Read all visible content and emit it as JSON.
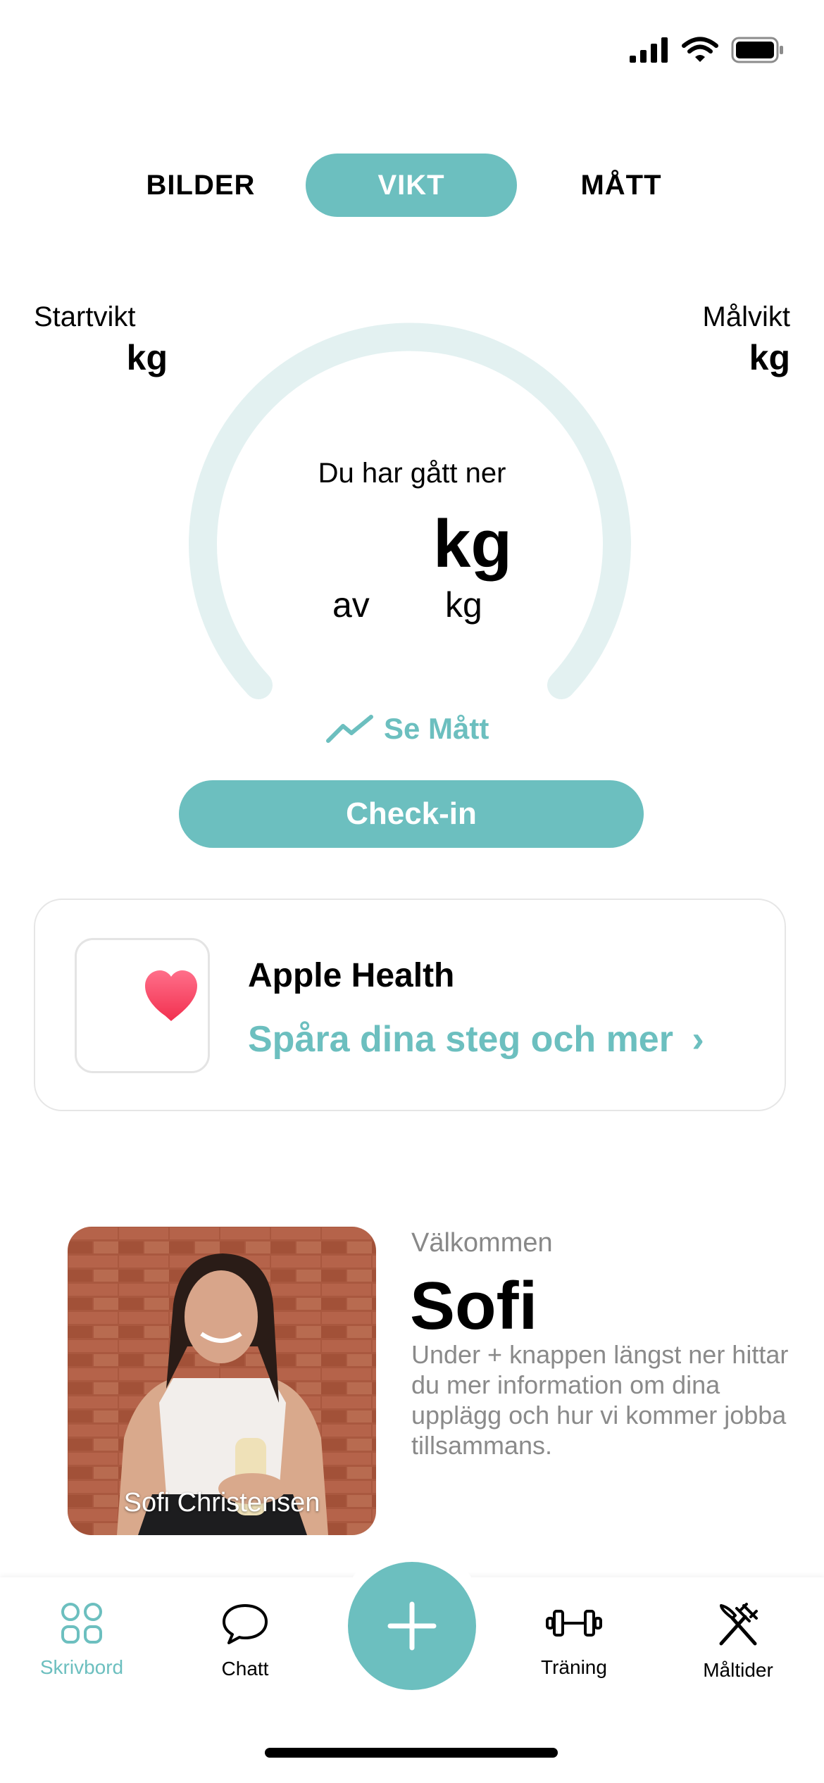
{
  "status_bar": {
    "icons": [
      "cellular-signal-icon",
      "wifi-icon",
      "battery-icon"
    ]
  },
  "tabs": [
    {
      "label": "BILDER",
      "active": false
    },
    {
      "label": "VIKT",
      "active": true
    },
    {
      "label": "MÅTT",
      "active": false
    }
  ],
  "weight": {
    "start_label": "Startvikt",
    "start_unit": "kg",
    "goal_label": "Målvikt",
    "goal_unit": "kg",
    "lost_label": "Du har gått ner",
    "lost_unit": "kg",
    "of_label": "av",
    "of_unit": "kg"
  },
  "see_matt": {
    "label": "Se Mått",
    "icon": "trend-line-icon"
  },
  "checkin": {
    "label": "Check-in"
  },
  "health_card": {
    "title": "Apple Health",
    "subtitle": "Spåra dina steg och mer",
    "chevron": "›",
    "icon": "heart-icon"
  },
  "welcome": {
    "label": "Välkommen",
    "name": "Sofi",
    "text": "Under + knappen längst ner hittar du mer information om dina upplägg och hur vi kommer jobba tillsammans.",
    "photo_caption": "Sofi Christensen"
  },
  "nav": {
    "items": [
      {
        "label": "Skrivbord",
        "icon": "grid-icon",
        "active": true
      },
      {
        "label": "Chatt",
        "icon": "chat-bubble-icon",
        "active": false
      },
      {
        "label": "Träning",
        "icon": "dumbbell-icon",
        "active": false
      },
      {
        "label": "Måltider",
        "icon": "fork-knife-icon",
        "active": false
      }
    ],
    "add_icon": "plus-icon"
  },
  "colors": {
    "accent": "#6cbfbf",
    "gauge_track": "#e3f1f1",
    "heart": "#f23d5c"
  }
}
